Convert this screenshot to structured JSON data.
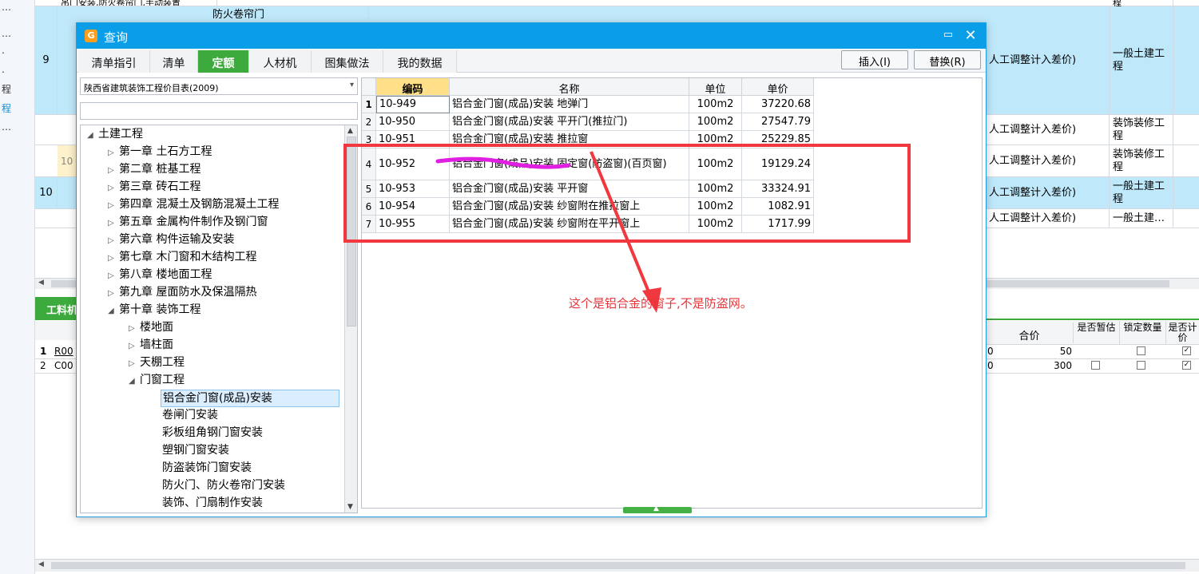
{
  "background_window": {
    "left_strip_fragments": [
      "…",
      "…",
      ".",
      ".",
      "程",
      "程",
      "…"
    ],
    "rows": [
      {
        "no": "",
        "text": "吊门安装,防火卷帘门,手动装置",
        "col_right": "",
        "type": "程"
      },
      {
        "no": "9",
        "text": "防火卷帘门",
        "col_right": "人工调整计入差价)",
        "type": "一般土建工程"
      },
      {
        "no": "",
        "text": "",
        "col_right": "人工调整计入差价)",
        "type": "装饰装修工程"
      },
      {
        "no": "10",
        "text": "",
        "col_right": "人工调整计入差价)",
        "type": "装饰装修工程"
      },
      {
        "no": "10",
        "text": "",
        "col_right": "人工调整计入差价)",
        "type": "一般土建工程"
      },
      {
        "no": "",
        "text": "",
        "col_right": "人工调整计入差价)",
        "type": "一般土建…"
      }
    ],
    "bottom_tab": "工料机",
    "bottom_headers": [
      "合价",
      "是否暂估",
      "锁定数量",
      "是否计价"
    ],
    "bottom_rows": [
      {
        "idx": "1",
        "code": "R00",
        "qty": "0",
        "total": "50",
        "est": false,
        "lock": false,
        "calc": true
      },
      {
        "idx": "2",
        "code": "C00",
        "qty": "0",
        "total": "300",
        "est": false,
        "lock": false,
        "calc": true
      }
    ]
  },
  "dialog": {
    "title": "查询",
    "tabs": [
      {
        "label": "清单指引",
        "active": false
      },
      {
        "label": "清单",
        "active": false
      },
      {
        "label": "定额",
        "active": true
      },
      {
        "label": "人材机",
        "active": false
      },
      {
        "label": "图集做法",
        "active": false
      },
      {
        "label": "我的数据",
        "active": false
      }
    ],
    "insert_button": "插入(I)",
    "replace_button": "替换(R)",
    "catalog_select": "陕西省建筑装饰工程价目表(2009)",
    "filter_value": "",
    "tree": [
      {
        "label": "土建工程",
        "level": 0,
        "expanded": true
      },
      {
        "label": "第一章 土石方工程",
        "level": 1,
        "expanded": false
      },
      {
        "label": "第二章 桩基工程",
        "level": 1,
        "expanded": false
      },
      {
        "label": "第三章 砖石工程",
        "level": 1,
        "expanded": false
      },
      {
        "label": "第四章 混凝土及钢筋混凝土工程",
        "level": 1,
        "expanded": false
      },
      {
        "label": "第五章 金属构件制作及钢门窗",
        "level": 1,
        "expanded": false
      },
      {
        "label": "第六章 构件运输及安装",
        "level": 1,
        "expanded": false
      },
      {
        "label": "第七章 木门窗和木结构工程",
        "level": 1,
        "expanded": false
      },
      {
        "label": "第八章 楼地面工程",
        "level": 1,
        "expanded": false
      },
      {
        "label": "第九章 屋面防水及保温隔热",
        "level": 1,
        "expanded": false
      },
      {
        "label": "第十章 装饰工程",
        "level": 1,
        "expanded": true
      },
      {
        "label": "楼地面",
        "level": 2,
        "expanded": false
      },
      {
        "label": "墙柱面",
        "level": 2,
        "expanded": false
      },
      {
        "label": "天棚工程",
        "level": 2,
        "expanded": false
      },
      {
        "label": "门窗工程",
        "level": 2,
        "expanded": true
      },
      {
        "label": "铝合金门窗(成品)安装",
        "level": 3,
        "selected": true
      },
      {
        "label": "卷闸门安装",
        "level": 3
      },
      {
        "label": "彩板组角钢门窗安装",
        "level": 3
      },
      {
        "label": "塑钢门窗安装",
        "level": 3
      },
      {
        "label": "防盗装饰门窗安装",
        "level": 3
      },
      {
        "label": "防火门、防火卷帘门安装",
        "level": 3
      },
      {
        "label": "装饰、门扇制作安装",
        "level": 3
      }
    ],
    "grid": {
      "headers": [
        "编码",
        "名称",
        "单位",
        "单价"
      ],
      "rows": [
        {
          "idx": "1",
          "code": "10-949",
          "name": "铝合金门窗(成品)安装 地弹门",
          "unit": "100m2",
          "price": "37220.68"
        },
        {
          "idx": "2",
          "code": "10-950",
          "name": "铝合金门窗(成品)安装 平开门(推拉门)",
          "unit": "100m2",
          "price": "27547.79"
        },
        {
          "idx": "3",
          "code": "10-951",
          "name": "铝合金门窗(成品)安装 推拉窗",
          "unit": "100m2",
          "price": "25229.85"
        },
        {
          "idx": "4",
          "code": "10-952",
          "name": "铝合金门窗(成品)安装 固定窗(防盗窗)(百页窗)",
          "unit": "100m2",
          "price": "19129.24"
        },
        {
          "idx": "5",
          "code": "10-953",
          "name": "铝合金门窗(成品)安装 平开窗",
          "unit": "100m2",
          "price": "33324.91"
        },
        {
          "idx": "6",
          "code": "10-954",
          "name": "铝合金门窗(成品)安装 纱窗附在推拉窗上",
          "unit": "100m2",
          "price": "1082.91"
        },
        {
          "idx": "7",
          "code": "10-955",
          "name": "铝合金门窗(成品)安装 纱窗附在平开窗上",
          "unit": "100m2",
          "price": "1717.99"
        }
      ]
    }
  },
  "annotation": {
    "text": "这个是铝合金的窗子,不是防盗网。",
    "color": "#e8333a",
    "underline_color": "#e020e0"
  },
  "colors": {
    "title_bar": "#0b9ee8",
    "active_tab": "#3daa3d",
    "highlight_row": "#bfe9fb",
    "code_header": "#ffe089"
  }
}
